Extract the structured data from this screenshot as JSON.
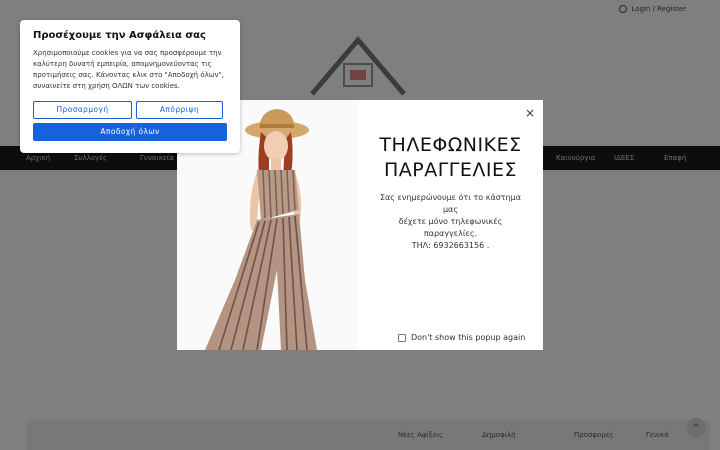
{
  "header": {
    "login_label": "Login / Register"
  },
  "nav": {
    "items": [
      {
        "label": "Αρχική"
      },
      {
        "label": "Συλλογές"
      },
      {
        "label": "Γυναικεία"
      },
      {
        "label": "Καινούργια"
      },
      {
        "label": "ΙΔΕΕΣ"
      },
      {
        "label": "Επαφή"
      }
    ]
  },
  "footer": {
    "links": [
      {
        "label": "Νέες Αφίξεις"
      },
      {
        "label": "Δημοφιλή"
      },
      {
        "label": "Προσφορές"
      },
      {
        "label": "Γενικά"
      }
    ]
  },
  "popup": {
    "title_line1": "ΤΗΛΕΦΩΝΙΚΕΣ",
    "title_line2": "ΠΑΡΑΓΓΕΛΙΕΣ",
    "text_line1": "Σας ενημερώνουμε ότι το κάστημα μας",
    "text_line2": "δέχετε μόνο τηλεφωνικές παραγγελίες.",
    "text_line3": "ΤΗΛ: 6932663156 .",
    "dont_show_label": "Don't show this popup again",
    "close_glyph": "×"
  },
  "cookie": {
    "title": "Προσέχουμε την Ασφάλεια σας",
    "description_line1": "Χρησιμοποιούμε cookies για να σας προσφέρουμε την",
    "description_line2": "καλύτερη δυνατή εμπειρία, απομνημονεύοντας τις",
    "description_line3": "προτιμήσεις σας. Κάνοντας κλικ στο \"Αποδοχή όλων\",",
    "description_line4": "συναινείτε στη χρήση ΟΛΩΝ των cookies.",
    "customize_label": "Προσαρμογή",
    "reject_label": "Απόρριψη",
    "accept_label": "Αποδοχή όλων"
  },
  "colors": {
    "accent": "#1863dc",
    "navbar": "#1a1a1a"
  }
}
